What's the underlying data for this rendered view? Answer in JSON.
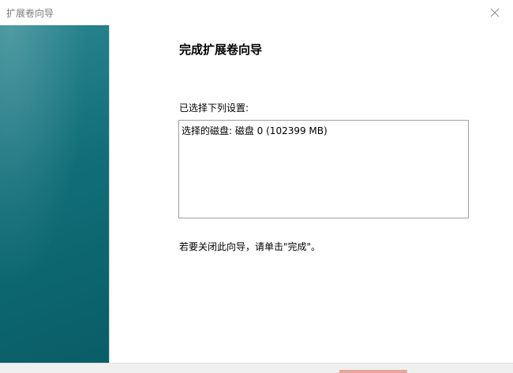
{
  "window": {
    "title": "扩展卷向导"
  },
  "wizard": {
    "heading": "完成扩展卷向导",
    "settings_label": "已选择下列设置:",
    "settings_lines": [
      "选择的磁盘: 磁盘 0 (102399 MB)"
    ],
    "finish_note": "若要关闭此向导，请单击\"完成\"。"
  },
  "icons": {
    "close": "close-icon"
  },
  "colors": {
    "side_panel_start": "#2a8590",
    "side_panel_end": "#0a5d66",
    "title_text": "#7a7a7a",
    "box_border": "#a0a0a0"
  }
}
